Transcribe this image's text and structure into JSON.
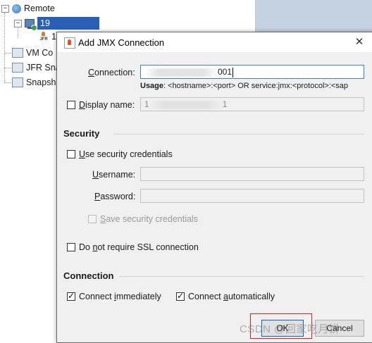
{
  "tree": {
    "remote_label": "Remote",
    "host_label": "19",
    "child_label": "1",
    "vm_label": "VM Co",
    "jfr_label": "JFR Sna",
    "snapshot_label": "Snapshot",
    "expand_symbol": "−",
    "jfr_icon_text": "JFR"
  },
  "dialog": {
    "title": "Add JMX Connection",
    "close_symbol": "✕",
    "connection_label_prefix": "C",
    "connection_label_rest": "onnection:",
    "connection_value_tail": "001",
    "usage_bold": "Usage",
    "usage_text": ": <hostname>:<port> OR service:jmx:<protocol>:<sap",
    "display_name_prefix": "D",
    "display_name_rest": "isplay name:",
    "display_name_checked": false,
    "display_name_value_head": "1",
    "display_name_value_tail": "1",
    "security_title": "Security",
    "use_security_prefix": "U",
    "use_security_rest": "se security credentials",
    "use_security_checked": false,
    "username_prefix": "U",
    "username_rest": "sername:",
    "password_prefix": "P",
    "password_rest": "assword:",
    "save_credentials_prefix": "S",
    "save_credentials_rest": "ave security credentials",
    "save_credentials_checked": false,
    "no_ssl_head": "Do ",
    "no_ssl_ul": "n",
    "no_ssl_rest": "ot require SSL connection",
    "no_ssl_checked": false,
    "connection_section_title": "Connection",
    "connect_immediately_head": "Connect ",
    "connect_immediately_ul": "i",
    "connect_immediately_rest": "mmediately",
    "connect_immediately_checked": true,
    "connect_automatically_head": "Connect ",
    "connect_automatically_ul": "a",
    "connect_automatically_rest": "utomatically",
    "connect_automatically_checked": true,
    "ok_label": "OK",
    "cancel_label": "Cancel"
  },
  "watermark": "CSDN @回家吃月饼",
  "colors": {
    "selection": "#2b5fb5",
    "dialog_bg": "#f0f0f0",
    "highlight_box": "#e02020",
    "right_panel": "#c5d2e2"
  }
}
